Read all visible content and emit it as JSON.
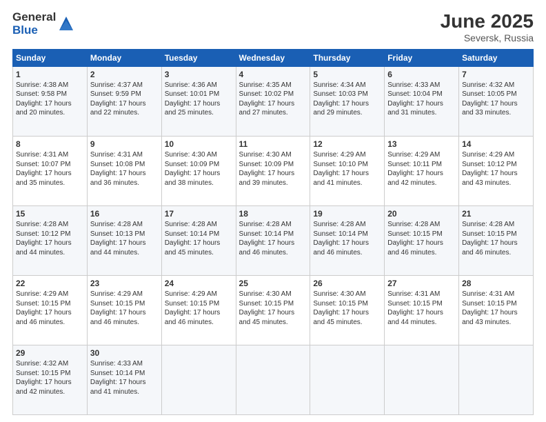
{
  "header": {
    "logo_general": "General",
    "logo_blue": "Blue",
    "month_title": "June 2025",
    "location": "Seversk, Russia"
  },
  "days_of_week": [
    "Sunday",
    "Monday",
    "Tuesday",
    "Wednesday",
    "Thursday",
    "Friday",
    "Saturday"
  ],
  "weeks": [
    [
      {
        "num": "1",
        "lines": [
          "Sunrise: 4:38 AM",
          "Sunset: 9:58 PM",
          "Daylight: 17 hours",
          "and 20 minutes."
        ]
      },
      {
        "num": "2",
        "lines": [
          "Sunrise: 4:37 AM",
          "Sunset: 9:59 PM",
          "Daylight: 17 hours",
          "and 22 minutes."
        ]
      },
      {
        "num": "3",
        "lines": [
          "Sunrise: 4:36 AM",
          "Sunset: 10:01 PM",
          "Daylight: 17 hours",
          "and 25 minutes."
        ]
      },
      {
        "num": "4",
        "lines": [
          "Sunrise: 4:35 AM",
          "Sunset: 10:02 PM",
          "Daylight: 17 hours",
          "and 27 minutes."
        ]
      },
      {
        "num": "5",
        "lines": [
          "Sunrise: 4:34 AM",
          "Sunset: 10:03 PM",
          "Daylight: 17 hours",
          "and 29 minutes."
        ]
      },
      {
        "num": "6",
        "lines": [
          "Sunrise: 4:33 AM",
          "Sunset: 10:04 PM",
          "Daylight: 17 hours",
          "and 31 minutes."
        ]
      },
      {
        "num": "7",
        "lines": [
          "Sunrise: 4:32 AM",
          "Sunset: 10:05 PM",
          "Daylight: 17 hours",
          "and 33 minutes."
        ]
      }
    ],
    [
      {
        "num": "8",
        "lines": [
          "Sunrise: 4:31 AM",
          "Sunset: 10:07 PM",
          "Daylight: 17 hours",
          "and 35 minutes."
        ]
      },
      {
        "num": "9",
        "lines": [
          "Sunrise: 4:31 AM",
          "Sunset: 10:08 PM",
          "Daylight: 17 hours",
          "and 36 minutes."
        ]
      },
      {
        "num": "10",
        "lines": [
          "Sunrise: 4:30 AM",
          "Sunset: 10:09 PM",
          "Daylight: 17 hours",
          "and 38 minutes."
        ]
      },
      {
        "num": "11",
        "lines": [
          "Sunrise: 4:30 AM",
          "Sunset: 10:09 PM",
          "Daylight: 17 hours",
          "and 39 minutes."
        ]
      },
      {
        "num": "12",
        "lines": [
          "Sunrise: 4:29 AM",
          "Sunset: 10:10 PM",
          "Daylight: 17 hours",
          "and 41 minutes."
        ]
      },
      {
        "num": "13",
        "lines": [
          "Sunrise: 4:29 AM",
          "Sunset: 10:11 PM",
          "Daylight: 17 hours",
          "and 42 minutes."
        ]
      },
      {
        "num": "14",
        "lines": [
          "Sunrise: 4:29 AM",
          "Sunset: 10:12 PM",
          "Daylight: 17 hours",
          "and 43 minutes."
        ]
      }
    ],
    [
      {
        "num": "15",
        "lines": [
          "Sunrise: 4:28 AM",
          "Sunset: 10:12 PM",
          "Daylight: 17 hours",
          "and 44 minutes."
        ]
      },
      {
        "num": "16",
        "lines": [
          "Sunrise: 4:28 AM",
          "Sunset: 10:13 PM",
          "Daylight: 17 hours",
          "and 44 minutes."
        ]
      },
      {
        "num": "17",
        "lines": [
          "Sunrise: 4:28 AM",
          "Sunset: 10:14 PM",
          "Daylight: 17 hours",
          "and 45 minutes."
        ]
      },
      {
        "num": "18",
        "lines": [
          "Sunrise: 4:28 AM",
          "Sunset: 10:14 PM",
          "Daylight: 17 hours",
          "and 46 minutes."
        ]
      },
      {
        "num": "19",
        "lines": [
          "Sunrise: 4:28 AM",
          "Sunset: 10:14 PM",
          "Daylight: 17 hours",
          "and 46 minutes."
        ]
      },
      {
        "num": "20",
        "lines": [
          "Sunrise: 4:28 AM",
          "Sunset: 10:15 PM",
          "Daylight: 17 hours",
          "and 46 minutes."
        ]
      },
      {
        "num": "21",
        "lines": [
          "Sunrise: 4:28 AM",
          "Sunset: 10:15 PM",
          "Daylight: 17 hours",
          "and 46 minutes."
        ]
      }
    ],
    [
      {
        "num": "22",
        "lines": [
          "Sunrise: 4:29 AM",
          "Sunset: 10:15 PM",
          "Daylight: 17 hours",
          "and 46 minutes."
        ]
      },
      {
        "num": "23",
        "lines": [
          "Sunrise: 4:29 AM",
          "Sunset: 10:15 PM",
          "Daylight: 17 hours",
          "and 46 minutes."
        ]
      },
      {
        "num": "24",
        "lines": [
          "Sunrise: 4:29 AM",
          "Sunset: 10:15 PM",
          "Daylight: 17 hours",
          "and 46 minutes."
        ]
      },
      {
        "num": "25",
        "lines": [
          "Sunrise: 4:30 AM",
          "Sunset: 10:15 PM",
          "Daylight: 17 hours",
          "and 45 minutes."
        ]
      },
      {
        "num": "26",
        "lines": [
          "Sunrise: 4:30 AM",
          "Sunset: 10:15 PM",
          "Daylight: 17 hours",
          "and 45 minutes."
        ]
      },
      {
        "num": "27",
        "lines": [
          "Sunrise: 4:31 AM",
          "Sunset: 10:15 PM",
          "Daylight: 17 hours",
          "and 44 minutes."
        ]
      },
      {
        "num": "28",
        "lines": [
          "Sunrise: 4:31 AM",
          "Sunset: 10:15 PM",
          "Daylight: 17 hours",
          "and 43 minutes."
        ]
      }
    ],
    [
      {
        "num": "29",
        "lines": [
          "Sunrise: 4:32 AM",
          "Sunset: 10:15 PM",
          "Daylight: 17 hours",
          "and 42 minutes."
        ]
      },
      {
        "num": "30",
        "lines": [
          "Sunrise: 4:33 AM",
          "Sunset: 10:14 PM",
          "Daylight: 17 hours",
          "and 41 minutes."
        ]
      },
      null,
      null,
      null,
      null,
      null
    ]
  ]
}
